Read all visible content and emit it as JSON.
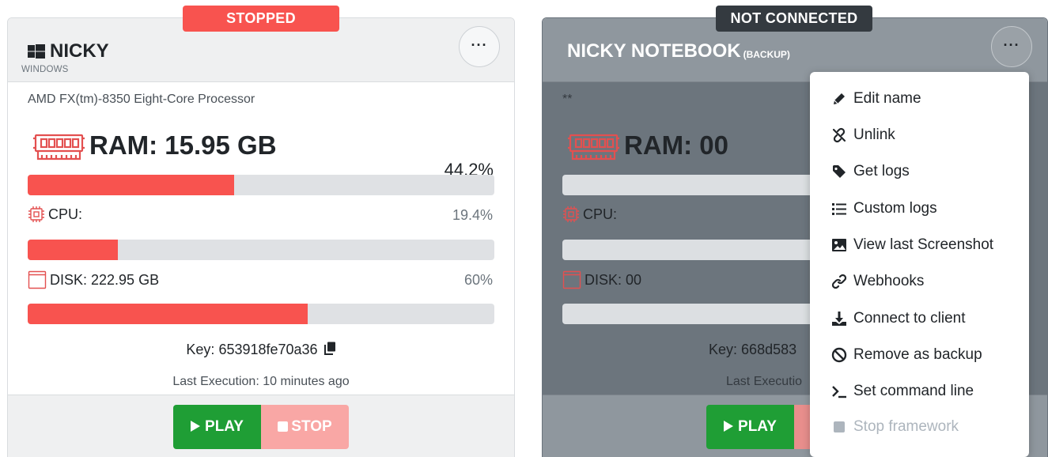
{
  "cards": [
    {
      "status": "STOPPED",
      "name": "NICKY",
      "os": "WINDOWS",
      "processor": "AMD FX(tm)-8350 Eight-Core Processor",
      "ram_label": "RAM: 15.95 GB",
      "ram_percent": "44.2%",
      "ram_fill": 0.442,
      "cpu_label": "CPU:",
      "cpu_percent": "19.4%",
      "cpu_fill": 0.194,
      "disk_label": "DISK: 222.95 GB",
      "disk_percent": "60%",
      "disk_fill": 0.6,
      "key_label": "Key:",
      "key_value": "653918fe70a36",
      "last_execution": "Last Execution: 10 minutes ago",
      "more_label": "···",
      "play_label": "PLAY",
      "stop_label": "STOP"
    },
    {
      "status": "NOT CONNECTED",
      "name": "NICKY NOTEBOOK",
      "name_suffix": "(BACKUP)",
      "processor": "**",
      "ram_label": "RAM: 00",
      "cpu_label": "CPU:",
      "disk_label": "DISK: 00",
      "key_label": "Key:",
      "key_value": "668d583",
      "last_execution": "Last Executio",
      "more_label": "···",
      "play_label": "PLAY"
    }
  ],
  "menu": {
    "items": [
      {
        "label": "Edit name",
        "icon": "pencil-icon"
      },
      {
        "label": "Unlink",
        "icon": "unlink-icon"
      },
      {
        "label": "Get logs",
        "icon": "tag-icon"
      },
      {
        "label": "Custom logs",
        "icon": "list-icon"
      },
      {
        "label": "View last Screenshot",
        "icon": "image-icon"
      },
      {
        "label": "Webhooks",
        "icon": "link-icon"
      },
      {
        "label": "Connect to client",
        "icon": "download-icon"
      },
      {
        "label": "Remove as backup",
        "icon": "ban-icon"
      },
      {
        "label": "Set command line",
        "icon": "terminal-icon"
      },
      {
        "label": "Stop framework",
        "icon": "stop-icon",
        "disabled": true
      }
    ]
  },
  "colors": {
    "danger": "#f8534f",
    "success": "#1f9e35",
    "dark": "#343a40",
    "muted_bar": "#dfe1e4"
  }
}
